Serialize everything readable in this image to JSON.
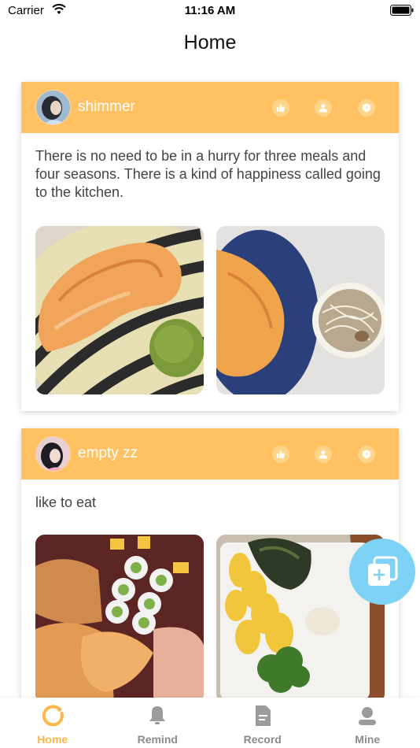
{
  "status": {
    "carrier": "Carrier",
    "time": "11:16 AM"
  },
  "nav": {
    "title": "Home"
  },
  "posts": [
    {
      "username": "shimmer",
      "text": "There is no need to be in a hurry for three meals and four seasons. There is a kind of happiness called going to the kitchen.",
      "photos": [
        "salmon-steak-striped-plate",
        "salmon-blue-plate-noodle-soup"
      ]
    },
    {
      "username": "empty zz",
      "text": "like to eat",
      "photos": [
        "sushi-platter",
        "corn-broccoli-rice"
      ]
    }
  ],
  "tabs": [
    {
      "label": "Home",
      "icon": "home-ring-icon",
      "active": true
    },
    {
      "label": "Remind",
      "icon": "bell-icon",
      "active": false
    },
    {
      "label": "Record",
      "icon": "document-icon",
      "active": false
    },
    {
      "label": "Mine",
      "icon": "person-icon",
      "active": false
    }
  ],
  "colors": {
    "accent": "#ffc162",
    "fab": "#7dd2f6",
    "active_tab": "#ffb648"
  }
}
